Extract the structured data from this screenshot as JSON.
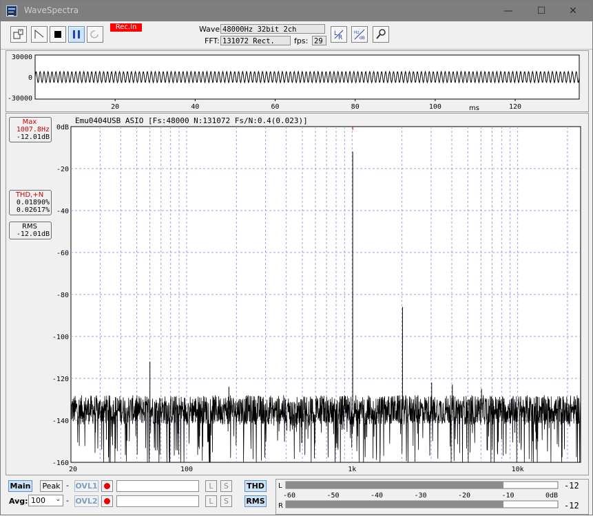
{
  "window": {
    "title": "WaveSpectra",
    "minimize": "—",
    "maximize": "☐",
    "close": "✕"
  },
  "toolbar": {
    "rec_in": "Rec.In",
    "wave_label": "Wave:",
    "wave_value": "48000Hz 32bit 2ch",
    "fft_label": "FFT:",
    "fft_value": "131072 Rect.",
    "fps_label": "fps:",
    "fps_value": "29",
    "record_progress": 0,
    "icons": [
      "open-file-icon",
      "wave-generator-icon",
      "stop-icon",
      "pause-icon",
      "repeat-icon",
      "lr-channel-icon",
      "hz-db-scale-icon",
      "settings-wrench-icon"
    ]
  },
  "waveform": {
    "y_ticks": [
      "30000",
      "0",
      "-30000"
    ],
    "x_ticks": [
      "20",
      "40",
      "60",
      "80",
      "100",
      "120"
    ],
    "x_unit": "ms"
  },
  "spectrum": {
    "header": "Emu0404USB ASIO  [Fs:48000 N:131072 Fs/N:0.4(0.023)]",
    "max_label": "Max",
    "max_freq": "1007.8Hz",
    "max_level": "-12.01dB",
    "thd_label": "THD,+N",
    "thd_value": "0.01890%",
    "thdn_value": "0.02617%",
    "rms_label": "RMS",
    "rms_value": "-12.01dB",
    "y_ticks": [
      "0dB",
      "-20",
      "-40",
      "-60",
      "-80",
      "-100",
      "-120",
      "-140",
      "-160"
    ],
    "x_ticks": [
      "20",
      "100",
      "1k",
      "10k"
    ]
  },
  "chart_data": {
    "type": "line",
    "x_scale": "log",
    "xlim": [
      20,
      24000
    ],
    "ylim": [
      -160,
      0
    ],
    "ylabel": "dB",
    "peaks": [
      {
        "freq": 60,
        "db": -112
      },
      {
        "freq": 180,
        "db": -124
      },
      {
        "freq": 1007.8,
        "db": -12.01
      },
      {
        "freq": 2015,
        "db": -86
      },
      {
        "freq": 3023,
        "db": -122
      },
      {
        "freq": 4031,
        "db": -123
      },
      {
        "freq": 6047,
        "db": -125
      }
    ],
    "noise_floor_db": [
      -140,
      -130
    ],
    "grid": true
  },
  "bottom": {
    "main": "Main",
    "peak": "Peak",
    "dash": "-",
    "ovl1": "OVL1",
    "ovl2": "OVL2",
    "avg_label": "Avg:",
    "avg_value": "100",
    "l": "L",
    "s": "S",
    "thd": "THD",
    "rms": "RMS",
    "meter_l": "L",
    "meter_r": "R",
    "meter_scale": [
      "-60",
      "-50",
      "-40",
      "-30",
      "-20",
      "-10",
      "0dB"
    ],
    "meter_l_value": "-12",
    "meter_r_value": "-12",
    "meter_l_level": 0.8,
    "meter_r_level": 0.8
  }
}
